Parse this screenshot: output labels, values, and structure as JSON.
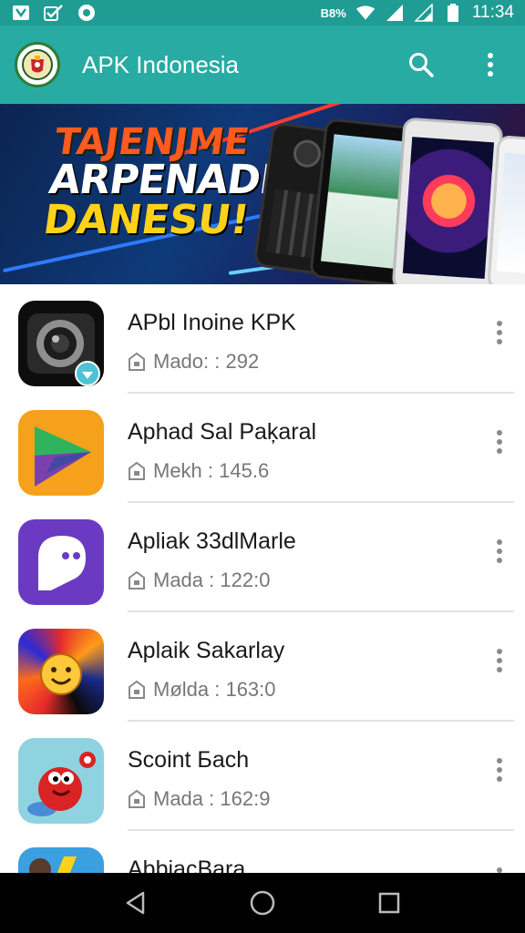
{
  "status_bar": {
    "network": "B8%",
    "time": "11:34",
    "icons": [
      "notification-icon",
      "checkbox-icon",
      "circle-icon",
      "nfc-icon",
      "wifi-icon",
      "signal-icon",
      "signal-icon",
      "battery-icon"
    ]
  },
  "app_bar": {
    "title": "APK Indonesia",
    "actions": [
      "search-icon",
      "overflow-menu-icon"
    ]
  },
  "banner": {
    "line1": "TAJENJME",
    "line2": "ARPENADIA",
    "line3": "DANESU!"
  },
  "apps": [
    {
      "title": "APbl Inoine KPK",
      "meta": "Mado: : 292",
      "icon": "camera-app-icon"
    },
    {
      "title": "Aphad Sal Paķaral",
      "meta": "Mekh : 145.6",
      "icon": "play-triangle-icon"
    },
    {
      "title": "Apliak 33dlMarle",
      "meta": "Mada : 122:0",
      "icon": "ghost-icon"
    },
    {
      "title": "Aplaik Sakarlay",
      "meta": "Mølda : 163:0",
      "icon": "smiley-icon"
    },
    {
      "title": "Scoint Бach",
      "meta": "Mada : 162:9",
      "icon": "cartoon-character-icon"
    },
    {
      "title": "AbbiacBara",
      "meta": "",
      "icon": "lightning-icon"
    }
  ],
  "colors": {
    "status_bar": "#1f9c93",
    "app_bar": "#28aba2",
    "nav_bar": "#000000"
  }
}
